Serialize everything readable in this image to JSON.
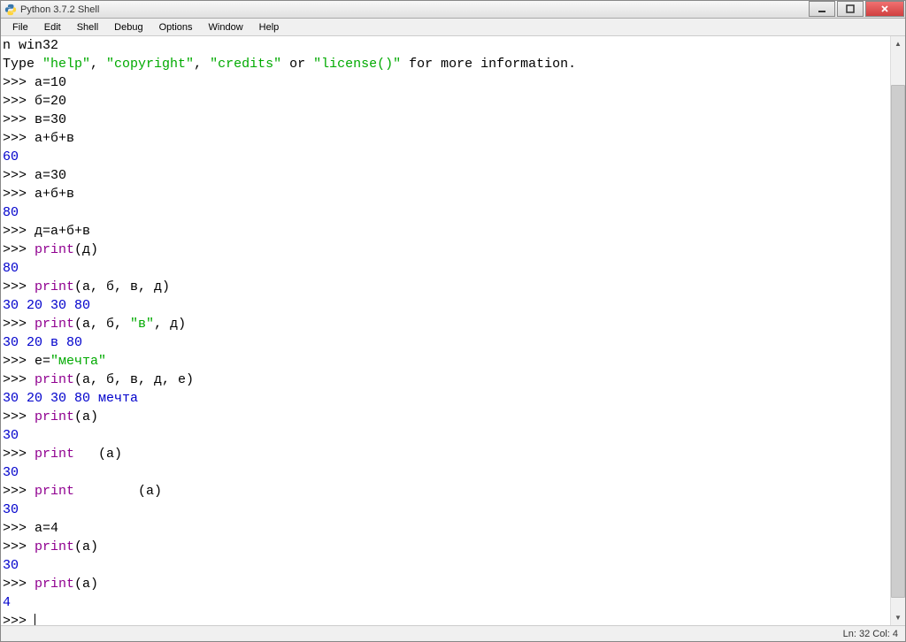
{
  "window": {
    "title": "Python 3.7.2 Shell"
  },
  "menu": {
    "file": "File",
    "edit": "Edit",
    "shell": "Shell",
    "debug": "Debug",
    "options": "Options",
    "window": "Window",
    "help": "Help"
  },
  "lines": {
    "l0": "n win32",
    "l1a": "Type ",
    "l1b": "\"help\"",
    "l1c": ", ",
    "l1d": "\"copyright\"",
    "l1e": ", ",
    "l1f": "\"credits\"",
    "l1g": " or ",
    "l1h": "\"license()\"",
    "l1i": " for more information.",
    "p": ">>> ",
    "l2": "а=10",
    "l3": "б=20",
    "l4": "в=30",
    "l5": "а+б+в",
    "o6": "60",
    "l7": "а=30",
    "l8": "а+б+в",
    "o9": "80",
    "l10": "д=а+б+в",
    "l11a": "print",
    "l11b": "(д)",
    "o12": "80",
    "l13a": "print",
    "l13b": "(а, б, в, д)",
    "o14": "30 20 30 80",
    "l15a": "print",
    "l15b": "(а, б, ",
    "l15c": "\"в\"",
    "l15d": ", д)",
    "o16": "30 20 в 80",
    "l17a": "е=",
    "l17b": "\"мечта\"",
    "l18a": "print",
    "l18b": "(а, б, в, д, е)",
    "o19": "30 20 30 80 мечта",
    "l20a": "print",
    "l20b": "(а)",
    "o21": "30",
    "l22a": "print",
    "l22b": "   (а)",
    "o23": "30",
    "l24a": "print",
    "l24b": "        (а)",
    "o25": "30",
    "l26": "а=4",
    "l27a": "print",
    "l27b": "(a)",
    "o28": "30",
    "l29a": "print",
    "l29b": "(а)",
    "o30": "4"
  },
  "status": {
    "position": "Ln: 32  Col: 4"
  }
}
